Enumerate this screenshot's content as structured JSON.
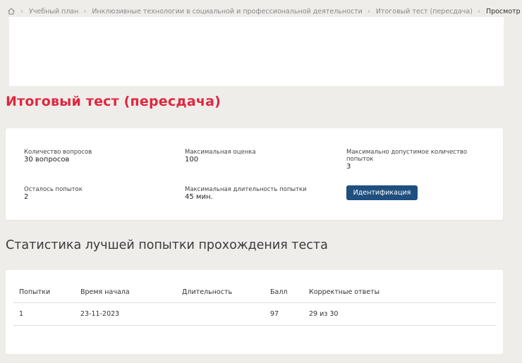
{
  "breadcrumb": {
    "items": [
      "Учебный план",
      "Инклюзивные технологии в социальной и профессиональной деятельности",
      "Итоговый тест (пересдача)",
      "Просмотр"
    ]
  },
  "page": {
    "title": "Итоговый тест (пересдача)"
  },
  "info": {
    "questions_count_label": "Количество вопросов",
    "questions_count_value": "30 вопросов",
    "max_score_label": "Максимальная оценка",
    "max_score_value": "100",
    "max_attempts_label": "Максимально допустимое количество попыток",
    "max_attempts_value": "3",
    "attempts_left_label": "Осталось попыток",
    "attempts_left_value": "2",
    "max_duration_label": "Максимальная длительность попытки",
    "max_duration_value": "45 мин.",
    "identification_button": "Идентификация"
  },
  "stats": {
    "section_title": "Статистика лучшей попытки прохождения теста",
    "columns": [
      "Попытки",
      "Время начала",
      "Длительность",
      "Балл",
      "Корректные ответы"
    ],
    "rows": [
      [
        "1",
        "23-11-2023",
        "",
        "97",
        "29 из 30"
      ]
    ]
  },
  "colors": {
    "title_red": "#e0263f",
    "button_blue": "#1f4f7f",
    "background": "#efedea"
  }
}
